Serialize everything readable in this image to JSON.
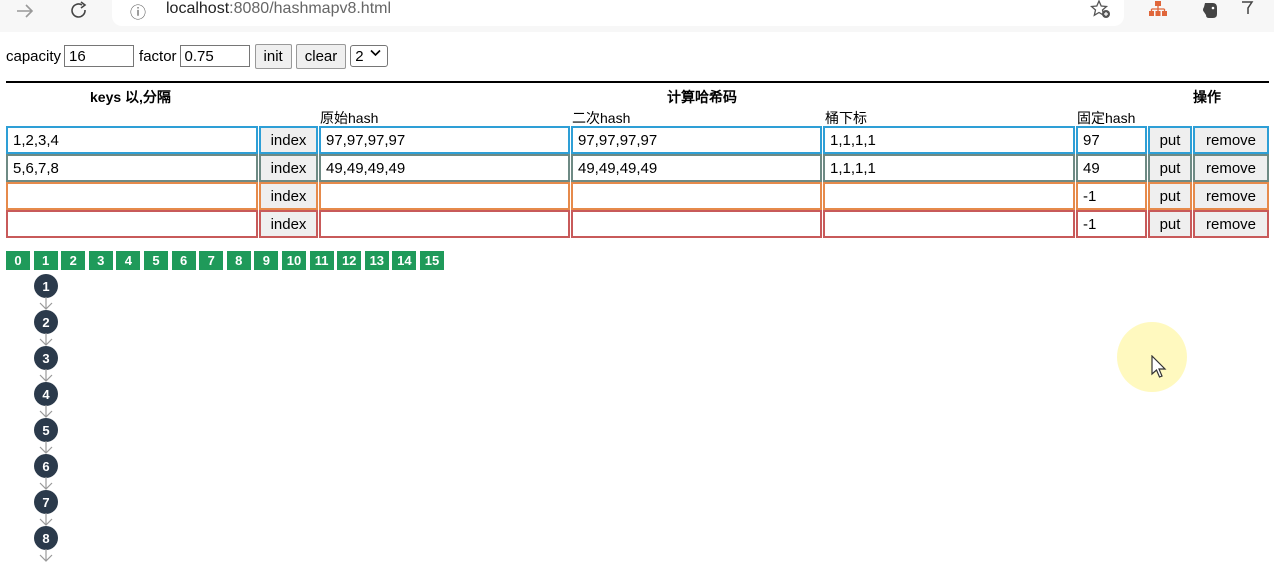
{
  "browser": {
    "url_host": "localhost",
    "url_path": ":8080/hashmapv8.html",
    "icons": [
      "forward-icon",
      "refresh-icon",
      "info-icon",
      "star-add-icon",
      "sitemap-extension-icon",
      "evernote-extension-icon",
      "filter-extension-icon"
    ]
  },
  "controls": {
    "capacity_label": "capacity",
    "capacity_value": "16",
    "factor_label": "factor",
    "factor_value": "0.75",
    "init_label": "init",
    "clear_label": "clear",
    "select_value": "2"
  },
  "table": {
    "headers": {
      "keys": "keys 以,分隔",
      "compute": "计算哈希码",
      "ops": "操作",
      "raw_hash": "原始hash",
      "second_hash": "二次hash",
      "bucket_index": "桶下标",
      "fixed_hash": "固定hash"
    },
    "index_label": "index",
    "put_label": "put",
    "remove_label": "remove",
    "rows": [
      {
        "keys": "1,2,3,4",
        "raw": "97,97,97,97",
        "second": "97,97,97,97",
        "bucket": "1,1,1,1",
        "fixed": "97",
        "color": "#2e9fd6"
      },
      {
        "keys": "5,6,7,8",
        "raw": "49,49,49,49",
        "second": "49,49,49,49",
        "bucket": "1,1,1,1",
        "fixed": "49",
        "color": "#6e8a84"
      },
      {
        "keys": "",
        "raw": "",
        "second": "",
        "bucket": "",
        "fixed": "-1",
        "color": "#e68a4b"
      },
      {
        "keys": "",
        "raw": "",
        "second": "",
        "bucket": "",
        "fixed": "-1",
        "color": "#c85a5a"
      }
    ]
  },
  "buckets": [
    "0",
    "1",
    "2",
    "3",
    "4",
    "5",
    "6",
    "7",
    "8",
    "9",
    "10",
    "11",
    "12",
    "13",
    "14",
    "15"
  ],
  "bucket_color": "#1f9a5a",
  "chain": {
    "bucket": "1",
    "nodes": [
      "1",
      "2",
      "3",
      "4",
      "5",
      "6",
      "7",
      "8"
    ],
    "node_color": "#2b3a4b"
  }
}
